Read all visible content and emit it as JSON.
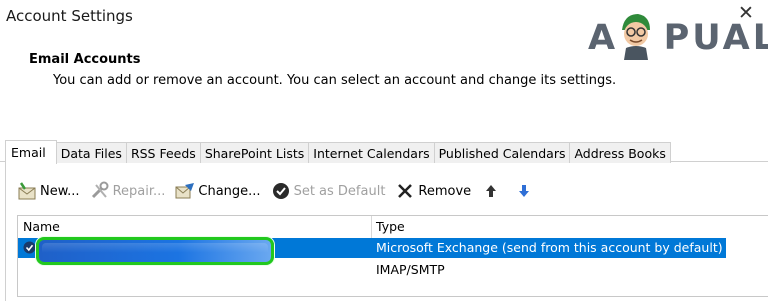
{
  "window": {
    "title": "Account Settings"
  },
  "watermark": {
    "text": "A  PUALS"
  },
  "section": {
    "title": "Email Accounts",
    "description": "You can add or remove an account. You can select an account and change its settings."
  },
  "tabs": [
    "Email",
    "Data Files",
    "RSS Feeds",
    "SharePoint Lists",
    "Internet Calendars",
    "Published Calendars",
    "Address Books"
  ],
  "active_tab": "Email",
  "toolbar": {
    "new_label": "New...",
    "repair_label": "Repair...",
    "change_label": "Change...",
    "set_default_label": "Set as Default",
    "remove_label": "Remove"
  },
  "accounts_list": {
    "columns": {
      "name": "Name",
      "type": "Type"
    },
    "rows": [
      {
        "name": "",
        "type": "Microsoft Exchange (send from this account by default)",
        "selected": true,
        "default": true
      },
      {
        "name": "",
        "type": "IMAP/SMTP",
        "selected": false,
        "default": false
      }
    ]
  },
  "colors": {
    "selection": "#0078d7",
    "highlight_outline": "#22c81e",
    "arrow_blue": "#2f6fd6"
  },
  "icons": [
    "close-icon",
    "new-account-icon",
    "repair-icon",
    "change-icon",
    "set-default-icon",
    "remove-icon",
    "move-up-icon",
    "move-down-icon",
    "default-check-icon"
  ]
}
